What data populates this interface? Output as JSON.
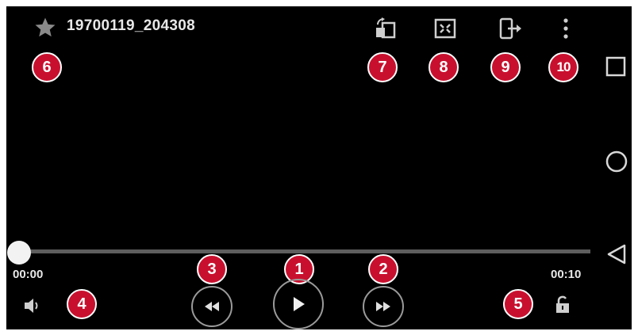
{
  "video": {
    "title": "19700119_204308",
    "current_time": "00:00",
    "total_time": "00:10",
    "progress": 0.0
  },
  "callouts": [
    "1",
    "2",
    "3",
    "4",
    "5",
    "6",
    "7",
    "8",
    "9",
    "10"
  ],
  "icons": {
    "favorite": "star-icon",
    "screen_rotate": "rotate-screen-icon",
    "fit_screen": "fit-screen-icon",
    "share_out": "share-device-icon",
    "more": "more-vertical-icon",
    "volume": "volume-icon",
    "rewind": "rewind-icon",
    "play": "play-icon",
    "fast_forward": "fast-forward-icon",
    "lock": "unlock-icon",
    "nav_recents": "square-icon",
    "nav_home": "circle-icon",
    "nav_back": "triangle-back-icon"
  },
  "colors": {
    "background": "#000000",
    "callout": "#c8102e",
    "progress_track": "#5e5e5e"
  }
}
